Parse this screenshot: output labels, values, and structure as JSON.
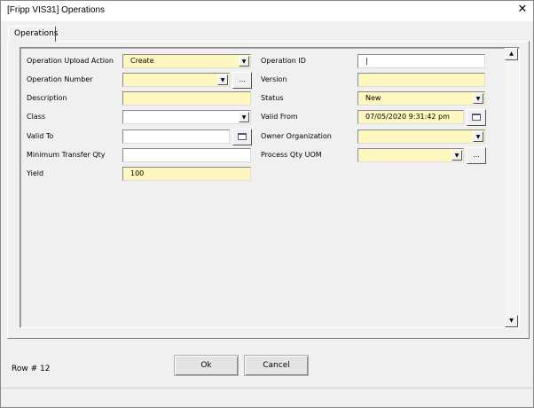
{
  "window": {
    "title": "[Fripp VIS31] Operations",
    "close_icon": "close-icon"
  },
  "tabs": [
    {
      "label": "Operations",
      "active": true
    }
  ],
  "left_fields": [
    {
      "label": "Operation Upload Action",
      "value": "Create",
      "type": "dropdown",
      "required": true
    },
    {
      "label": "Operation Number",
      "value": "",
      "type": "dropdown-lookup",
      "required": true,
      "button": "..."
    },
    {
      "label": "Description",
      "value": "",
      "type": "text",
      "required": true
    },
    {
      "label": "Class",
      "value": "",
      "type": "dropdown",
      "required": false
    },
    {
      "label": "Valid To",
      "value": "",
      "type": "date",
      "required": false
    },
    {
      "label": "Minimum Transfer Qty",
      "value": "",
      "type": "text",
      "required": false
    },
    {
      "label": "Yield",
      "value": "100",
      "type": "text",
      "required": true
    }
  ],
  "right_fields": [
    {
      "label": "Operation ID",
      "value": "",
      "type": "text",
      "required": false
    },
    {
      "label": "Version",
      "value": "",
      "type": "text",
      "required": true
    },
    {
      "label": "Status",
      "value": "New",
      "type": "dropdown",
      "required": true
    },
    {
      "label": "Valid From",
      "value": "07/05/2020 9:31:42 pm",
      "type": "date",
      "required": true
    },
    {
      "label": "Owner Organization",
      "value": "",
      "type": "dropdown",
      "required": true
    },
    {
      "label": "Process Qty UOM",
      "value": "",
      "type": "dropdown-lookup",
      "required": true,
      "button": "..."
    }
  ],
  "footer": {
    "row_label": "Row # 12",
    "ok": "Ok",
    "cancel": "Cancel"
  },
  "colors": {
    "required_field": "#fef8c0",
    "optional_field": "#ffffff"
  }
}
